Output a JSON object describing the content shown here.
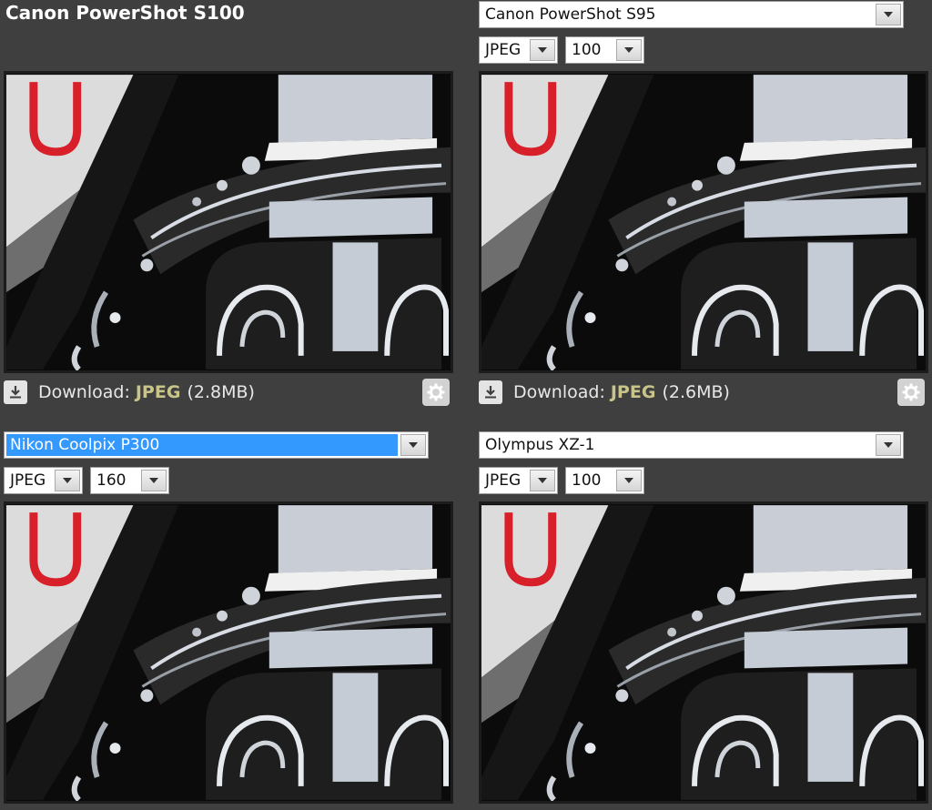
{
  "panels": {
    "top_left": {
      "title": "Canon PowerShot S100",
      "download": {
        "label": "Download:",
        "format": "JPEG",
        "size": "(2.8MB)"
      }
    },
    "top_right": {
      "camera_select": "Canon PowerShot S95",
      "format_select": "JPEG",
      "iso_select": "100",
      "download": {
        "label": "Download:",
        "format": "JPEG",
        "size": "(2.6MB)"
      }
    },
    "bottom_left": {
      "camera_select": "Nikon Coolpix P300",
      "format_select": "JPEG",
      "iso_select": "160"
    },
    "bottom_right": {
      "camera_select": "Olympus XZ-1",
      "format_select": "JPEG",
      "iso_select": "100"
    }
  },
  "icons": {
    "download": "download-icon",
    "settings": "gear-icon",
    "dropdown": "chevron-down-icon"
  },
  "colors": {
    "background": "#3f3f3f",
    "format_highlight": "#c9c48a",
    "selection": "#3399ff"
  }
}
